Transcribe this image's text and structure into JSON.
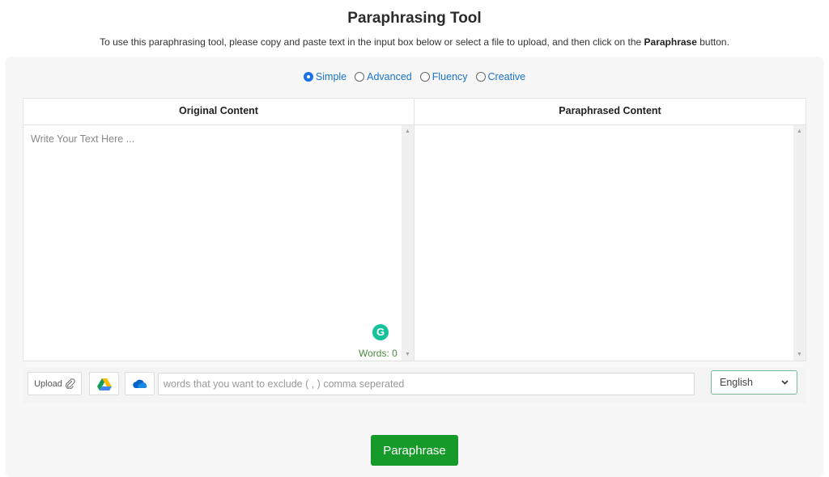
{
  "header": {
    "title": "Paraphrasing Tool",
    "subtitle_pre": "To use this paraphrasing tool, please copy and paste text in the input box below or select a file to upload, and then click on the ",
    "subtitle_bold": "Paraphrase",
    "subtitle_post": " button."
  },
  "modes": [
    {
      "label": "Simple",
      "checked": true
    },
    {
      "label": "Advanced",
      "checked": false
    },
    {
      "label": "Fluency",
      "checked": false
    },
    {
      "label": "Creative",
      "checked": false
    }
  ],
  "original": {
    "header": "Original Content",
    "placeholder": "Write Your Text Here ...",
    "value": "",
    "grammarly_glyph": "G",
    "word_count_label": "Words: 0"
  },
  "paraphrased": {
    "header": "Paraphrased Content",
    "value": ""
  },
  "scroll": {
    "up": "▲",
    "down": "▼"
  },
  "toolbar": {
    "upload_label": "Upload",
    "upload_icon": "paperclip-icon",
    "gdrive_icon": "google-drive-icon",
    "onedrive_icon": "onedrive-icon",
    "exclude_placeholder": "words that you want to exclude ( , ) comma seperated",
    "exclude_value": "",
    "language_selected": "English",
    "language_chevron": "⌄"
  },
  "action": {
    "paraphrase_label": "Paraphrase"
  },
  "colors": {
    "accent_green": "#169b2b",
    "radio_blue": "#1a73e8",
    "grammarly": "#15c39a",
    "word_count": "#4b8a3c"
  }
}
